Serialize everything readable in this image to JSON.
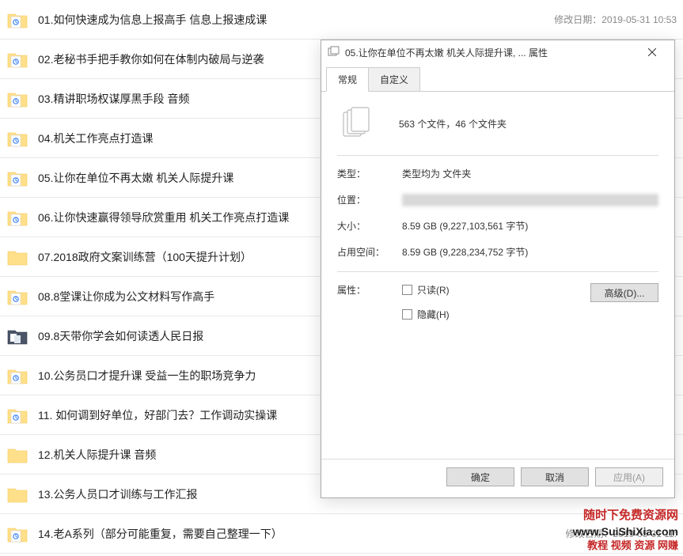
{
  "date_label": "修改日期：",
  "items": [
    {
      "name": "01.如何快速成为信息上报高手 信息上报速成课",
      "date": "2019-05-31 10:53",
      "icon": "folder-blue"
    },
    {
      "name": "02.老秘书手把手教你如何在体制内破局与逆袭",
      "date": "",
      "icon": "folder-blue"
    },
    {
      "name": "03.精讲职场权谋厚黑手段 音频",
      "date": "",
      "icon": "folder-blue"
    },
    {
      "name": "04.机关工作亮点打造课",
      "date": "",
      "icon": "folder-blue"
    },
    {
      "name": "05.让你在单位不再太嫩  机关人际提升课",
      "date": "",
      "icon": "folder-blue"
    },
    {
      "name": "06.让你快速赢得领导欣赏重用  机关工作亮点打造课",
      "date": "",
      "icon": "folder-blue"
    },
    {
      "name": "07.2018政府文案训练营（100天提升计划）",
      "date": "",
      "icon": "folder"
    },
    {
      "name": "08.8堂课让你成为公文材料写作高手",
      "date": "",
      "icon": "folder-blue"
    },
    {
      "name": "09.8天带你学会如何读透人民日报",
      "date": "",
      "icon": "folder-dark"
    },
    {
      "name": "10.公务员口才提升课  受益一生的职场竞争力",
      "date": "",
      "icon": "folder-blue"
    },
    {
      "name": "11. 如何调到好单位，好部门去？工作调动实操课",
      "date": "",
      "icon": "folder-blue"
    },
    {
      "name": "12.机关人际提升课 音频",
      "date": "",
      "icon": "folder"
    },
    {
      "name": "13.公务人员口才训练与工作汇报",
      "date": "",
      "icon": "folder"
    },
    {
      "name": "14.老A系列（部分可能重复，需要自己整理一下）",
      "date": "2019-05-31 11:",
      "icon": "folder-blue"
    }
  ],
  "dialog": {
    "title": "05.让你在单位不再太嫩  机关人际提升课, ... 属性",
    "tabs": {
      "general": "常规",
      "custom": "自定义"
    },
    "file_count": "563 个文件，46 个文件夹",
    "rows": {
      "type_label": "类型：",
      "type_value": "类型均为 文件夹",
      "location_label": "位置：",
      "size_label": "大小：",
      "size_value": "8.59 GB (9,227,103,561 字节)",
      "disk_label": "占用空间：",
      "disk_value": "8.59 GB (9,228,234,752 字节)",
      "attr_label": "属性：",
      "readonly": "只读(R)",
      "hidden": "隐藏(H)",
      "advanced": "高级(D)..."
    },
    "buttons": {
      "ok": "确定",
      "cancel": "取消",
      "apply": "应用(A)"
    }
  },
  "watermark": {
    "line1": "随时下免费资源网",
    "line2": "www.SuiShiXia.com",
    "line3": "教程 视频 资源 网赚"
  }
}
